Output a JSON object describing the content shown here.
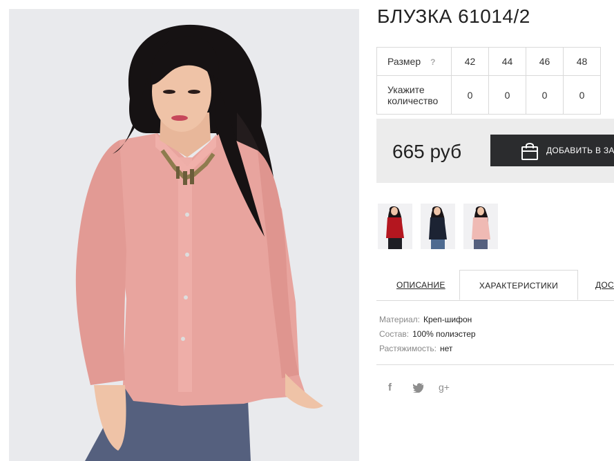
{
  "product": {
    "title": "БЛУЗКА 61014/2",
    "price": "665 руб",
    "add_to_cart": "ДОБАВИТЬ В ЗАКАЗ"
  },
  "size_table": {
    "size_label": "Размер",
    "help": "?",
    "qty_label_line1": "Укажите",
    "qty_label_line2": "количество",
    "sizes": [
      "42",
      "44",
      "46",
      "48"
    ],
    "quantities": [
      "0",
      "0",
      "0",
      "0"
    ]
  },
  "tabs": {
    "description": "ОПИСАНИЕ",
    "characteristics": "ХАРАКТЕРИСТИКИ",
    "delivery": "ДОСТАВКА"
  },
  "specs": [
    {
      "key": "Материал:",
      "value": "Креп-шифон"
    },
    {
      "key": "Состав:",
      "value": "100% полиэстер"
    },
    {
      "key": "Растяжимость:",
      "value": "нет"
    }
  ],
  "social": {
    "facebook": "f",
    "google_plus": "g+"
  },
  "colors": {
    "blouse_pink": "#e8a49e",
    "button_dark": "#2b2c2e",
    "price_bg": "#ececec",
    "thumb_red": "#b4161f",
    "thumb_navy": "#1c2333",
    "thumb_pink": "#efbab4"
  }
}
